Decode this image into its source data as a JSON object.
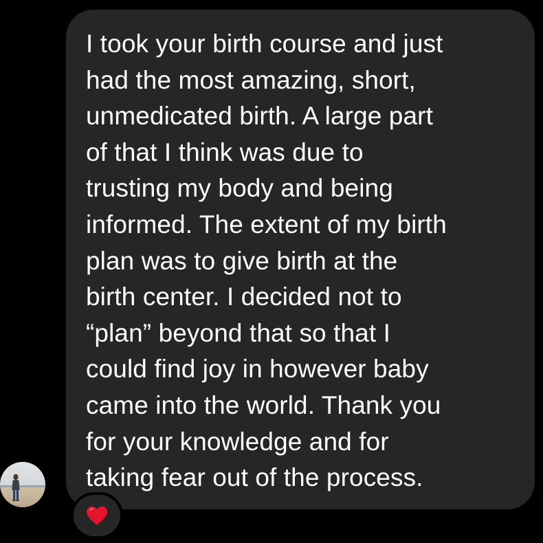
{
  "message": {
    "lines": [
      "I took your birth course and just",
      "had the most amazing, short,",
      "unmedicated birth. A large part",
      "of that I think was due to",
      "trusting my body and being",
      "informed. The extent of my birth",
      "plan was to give birth at the",
      "birth center. I decided not to",
      "“plan” beyond that so that I",
      "could find joy in however baby",
      "came into the world. Thank you",
      "for your knowledge and for",
      "taking fear out of the process."
    ]
  },
  "sender": {
    "avatar_icon": "user-avatar"
  },
  "reaction": {
    "icon": "red-heart-icon",
    "color": "#e4142f"
  },
  "colors": {
    "background": "#000000",
    "bubble": "#262626",
    "text": "#ffffff"
  }
}
